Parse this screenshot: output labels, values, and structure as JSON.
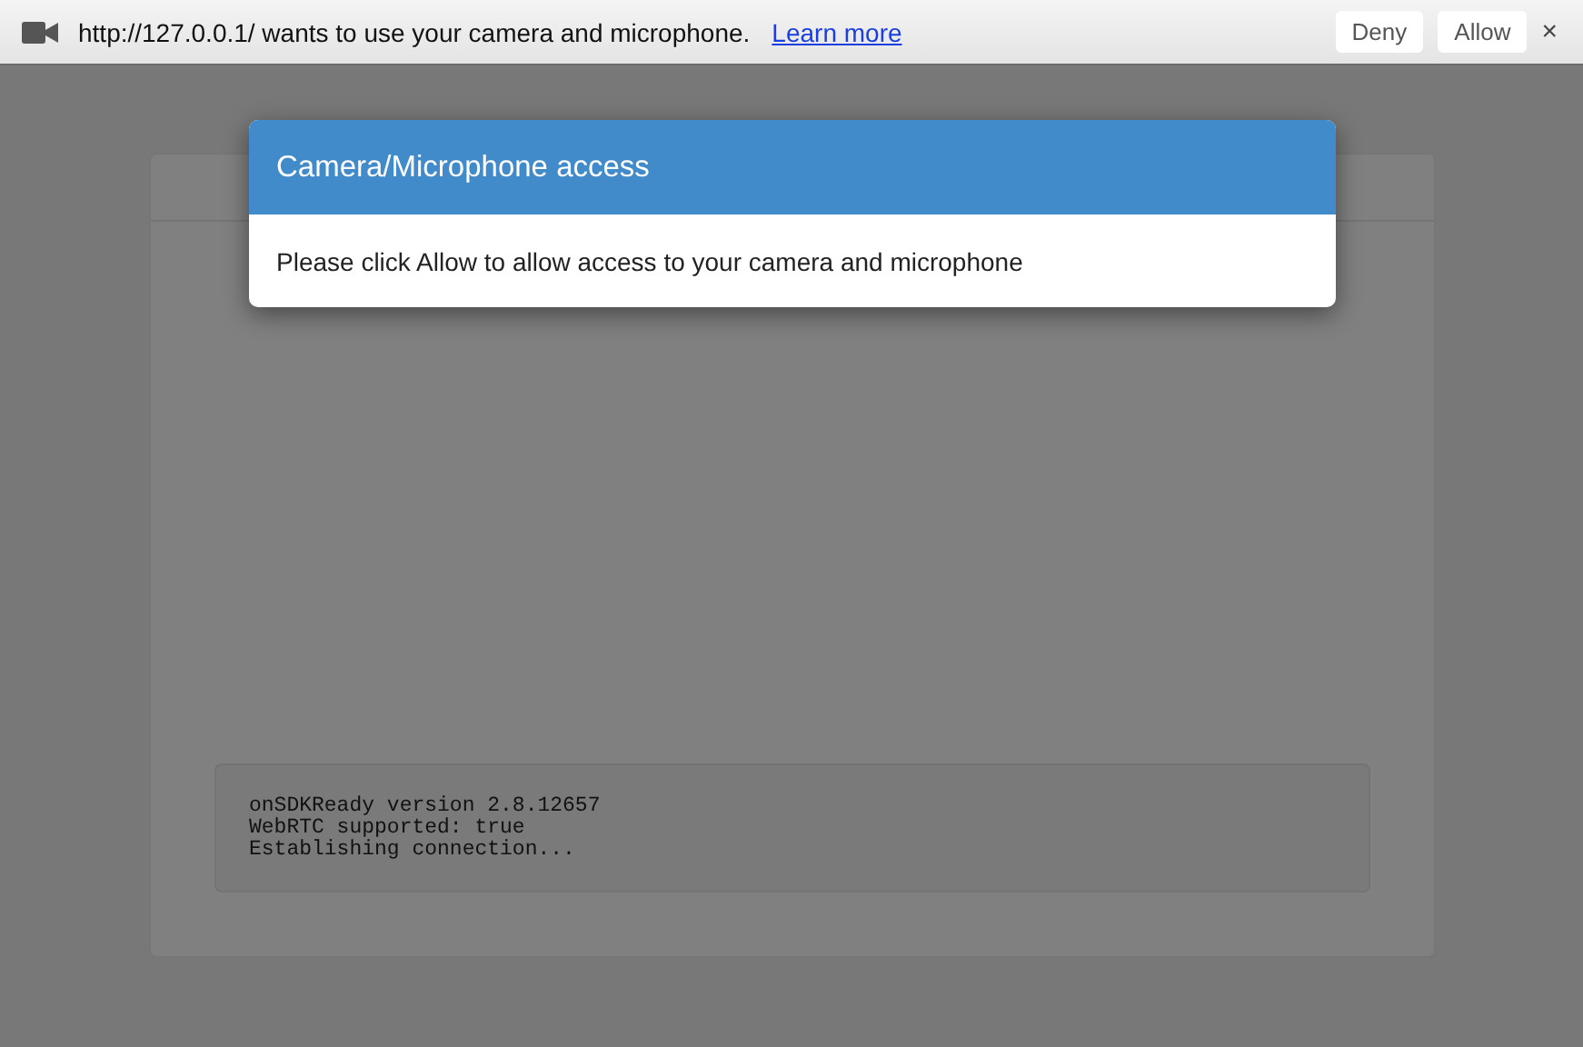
{
  "permission_bar": {
    "message": "http://127.0.0.1/ wants to use your camera and microphone.",
    "link": "Learn more",
    "buttons": [
      "Deny",
      "Allow"
    ],
    "close": "×"
  },
  "modal": {
    "title": "Camera/Microphone access",
    "body": "Please click Allow to allow access to your camera and microphone"
  },
  "log": [
    "onSDKReady version 2.8.12657",
    "WebRTC supported: true",
    "Establishing connection..."
  ]
}
